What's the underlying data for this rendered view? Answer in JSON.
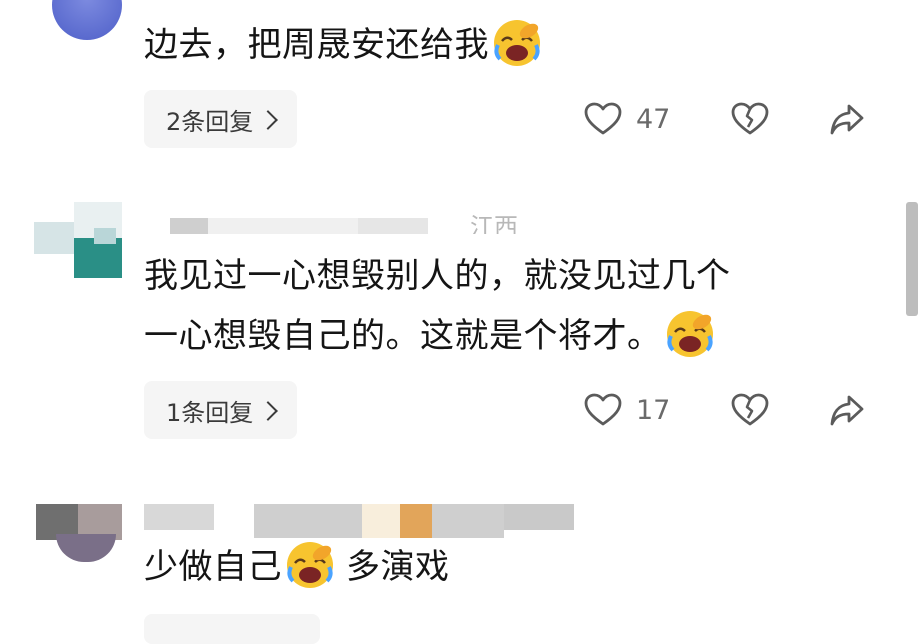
{
  "comments": [
    {
      "text": "边去，把周晟安还给我",
      "reply_label": "2条回复",
      "likes": "47"
    },
    {
      "location": "江西",
      "line1": "我见过一心想毁别人的，就没见过几个",
      "line2": "一心想毁自己的。这就是个将才。",
      "reply_label": "1条回复",
      "likes": "17"
    },
    {
      "text_before_emoji": "少做自己",
      "text_after_emoji": "多演戏"
    }
  ],
  "icons": {
    "like": "heart-outline-icon",
    "dislike": "broken-heart-icon",
    "share": "share-arrow-icon",
    "emoji": "laughing-crying-emoji"
  },
  "colors": {
    "background": "#ffffff",
    "text": "#151515",
    "muted": "#6a6a6a",
    "pill": "#f5f5f5"
  }
}
